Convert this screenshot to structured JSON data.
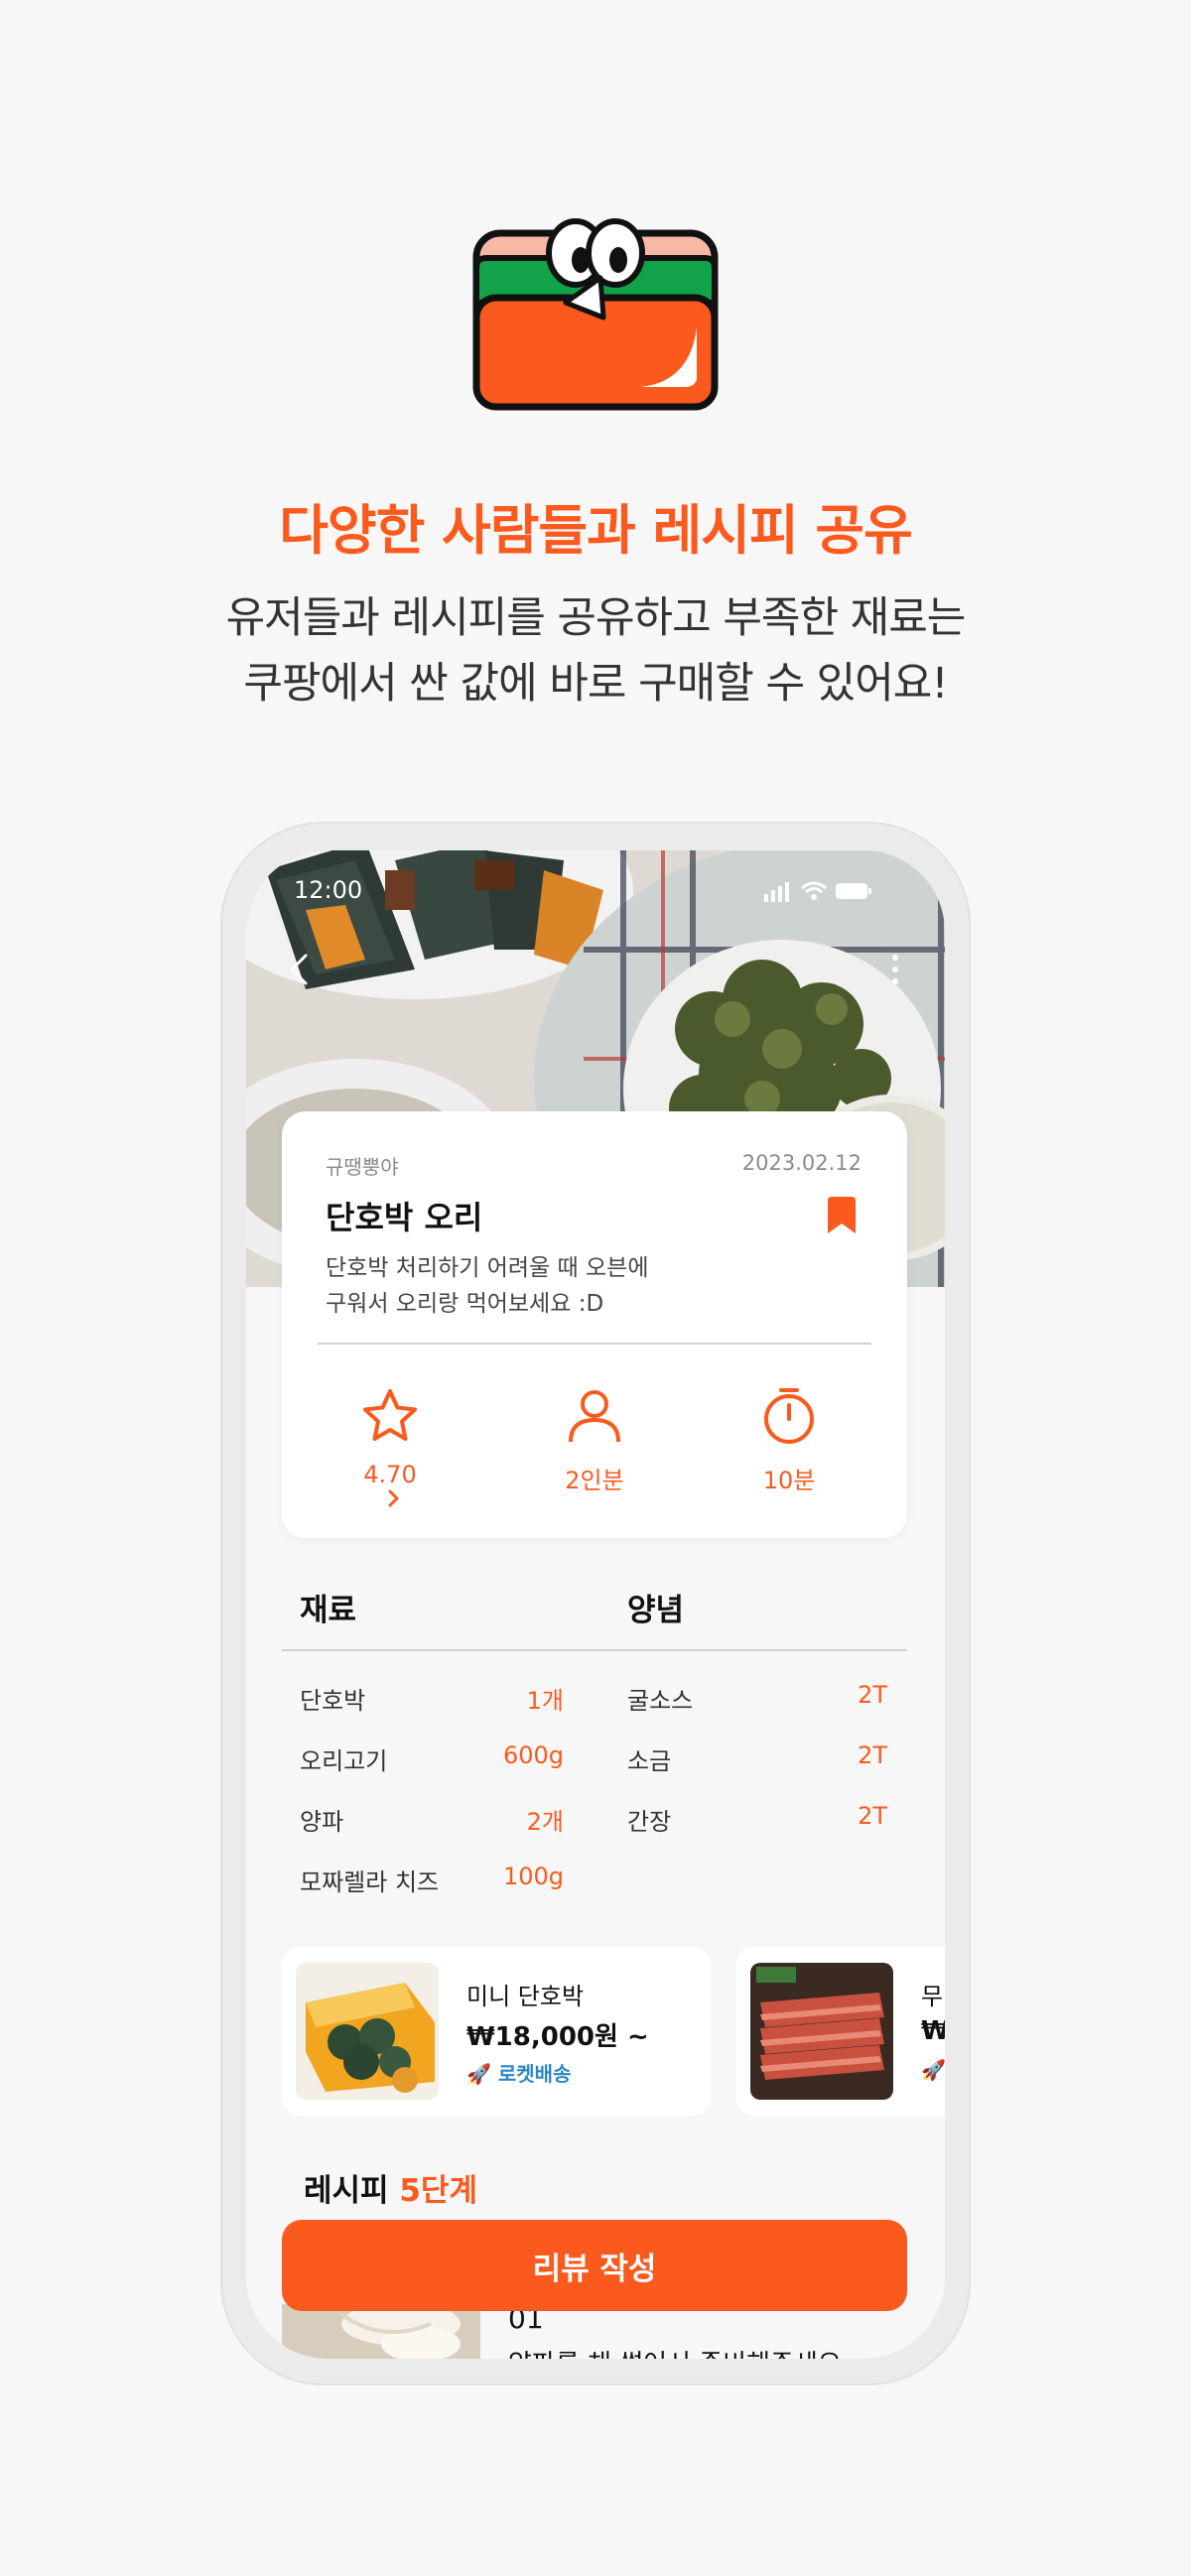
{
  "headline": "다양한 사람들과 레시피 공유",
  "subline": [
    "유저들과 레시피를 공유하고 부족한 재료는",
    "쿠팡에서 싼 값에 바로 구매할 수 있어요!"
  ],
  "status": {
    "time": "12:00"
  },
  "recipe": {
    "author": "규땡뿡야",
    "date": "2023.02.12",
    "title": "단호박 오리",
    "description": [
      "단호박 처리하기 어려울 때 오븐에",
      "구워서 오리랑 먹어보세요 :D"
    ],
    "rating": "4.70",
    "servings": "2인분",
    "time": "10분"
  },
  "ingredients": {
    "heading": "재료",
    "items": [
      {
        "name": "단호박",
        "amount": "1개"
      },
      {
        "name": "오리고기",
        "amount": "600g"
      },
      {
        "name": "양파",
        "amount": "2개"
      },
      {
        "name": "모짜렐라 치즈",
        "amount": "100g"
      }
    ]
  },
  "seasoning": {
    "heading": "양념",
    "items": [
      {
        "name": "굴소스",
        "amount": "2T"
      },
      {
        "name": "소금",
        "amount": "2T"
      },
      {
        "name": "간장",
        "amount": "2T"
      }
    ]
  },
  "products": [
    {
      "name": "미니 단호박",
      "price": "₩18,000원 ~",
      "shipping": "로켓배송"
    },
    {
      "name": "무",
      "price": "₩",
      "shipping": ""
    }
  ],
  "recipe_steps": {
    "label": "레시피",
    "count": "5단계",
    "step_number": "01",
    "step_text": "양파를 채 썰어서 준비해주세요"
  },
  "review_button": "리뷰 작성",
  "colors": {
    "accent": "#fa5a1e",
    "rocket": "#2a87c4"
  }
}
